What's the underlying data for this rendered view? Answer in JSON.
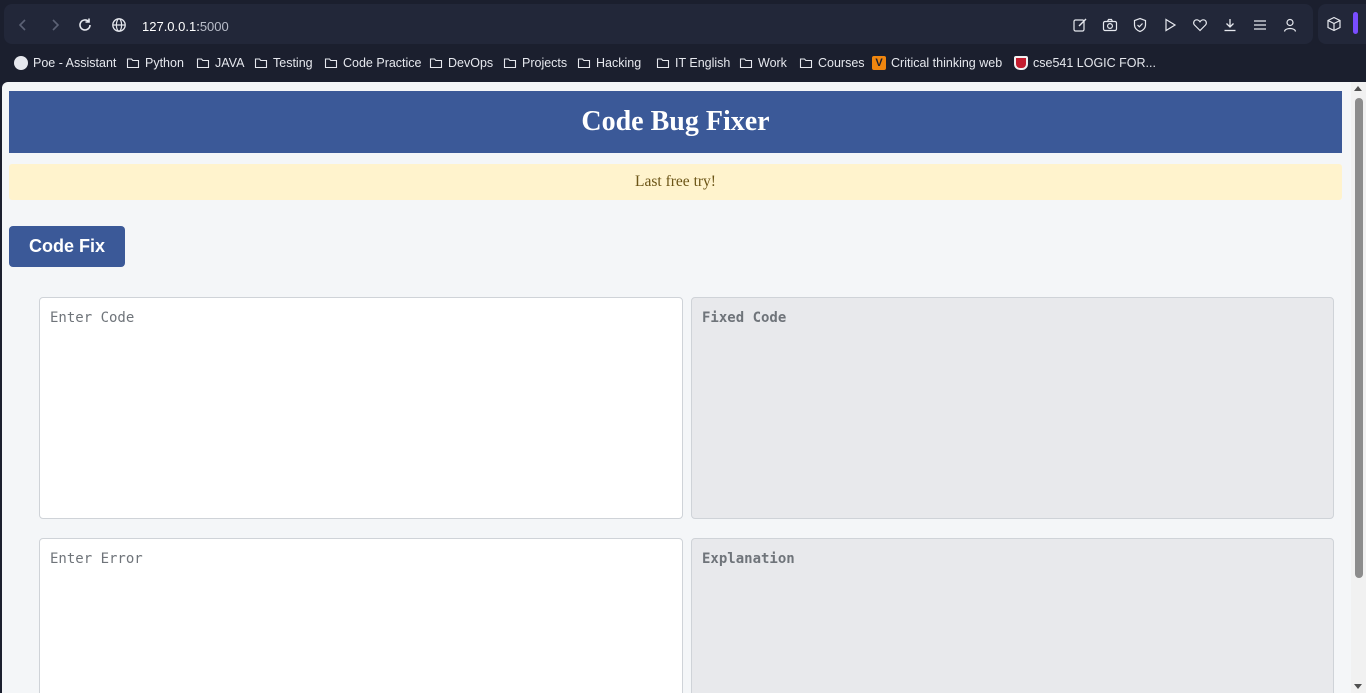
{
  "browser": {
    "url_host": "127.0.0.1:",
    "url_port": "5000"
  },
  "bookmarks": [
    {
      "label": "Poe - Assistant",
      "icon": "poe-icon"
    },
    {
      "label": "Python",
      "icon": "folder-icon"
    },
    {
      "label": "JAVA",
      "icon": "folder-icon"
    },
    {
      "label": "Testing",
      "icon": "folder-icon"
    },
    {
      "label": "Code Practice",
      "icon": "folder-icon"
    },
    {
      "label": "DevOps",
      "icon": "folder-icon"
    },
    {
      "label": "Projects",
      "icon": "folder-icon"
    },
    {
      "label": "Hacking",
      "icon": "folder-icon"
    },
    {
      "label": "IT English",
      "icon": "folder-icon"
    },
    {
      "label": "Work",
      "icon": "folder-icon"
    },
    {
      "label": "Courses",
      "icon": "folder-icon"
    },
    {
      "label": "Critical thinking web",
      "icon": "v-logo-icon"
    },
    {
      "label": "cse541 LOGIC FOR...",
      "icon": "shield-logo-icon"
    }
  ],
  "page": {
    "title": "Code Bug Fixer",
    "notice": "Last free try!",
    "fix_button": "Code Fix",
    "code_placeholder": "Enter Code",
    "fixed_code_placeholder": "Fixed Code",
    "error_placeholder": "Enter Error",
    "explanation_placeholder": "Explanation"
  },
  "colors": {
    "header_bg": "#3b5998",
    "notice_bg": "#fff3cd",
    "page_bg": "#f4f6f8",
    "browser_bg": "#1b1f2e"
  }
}
